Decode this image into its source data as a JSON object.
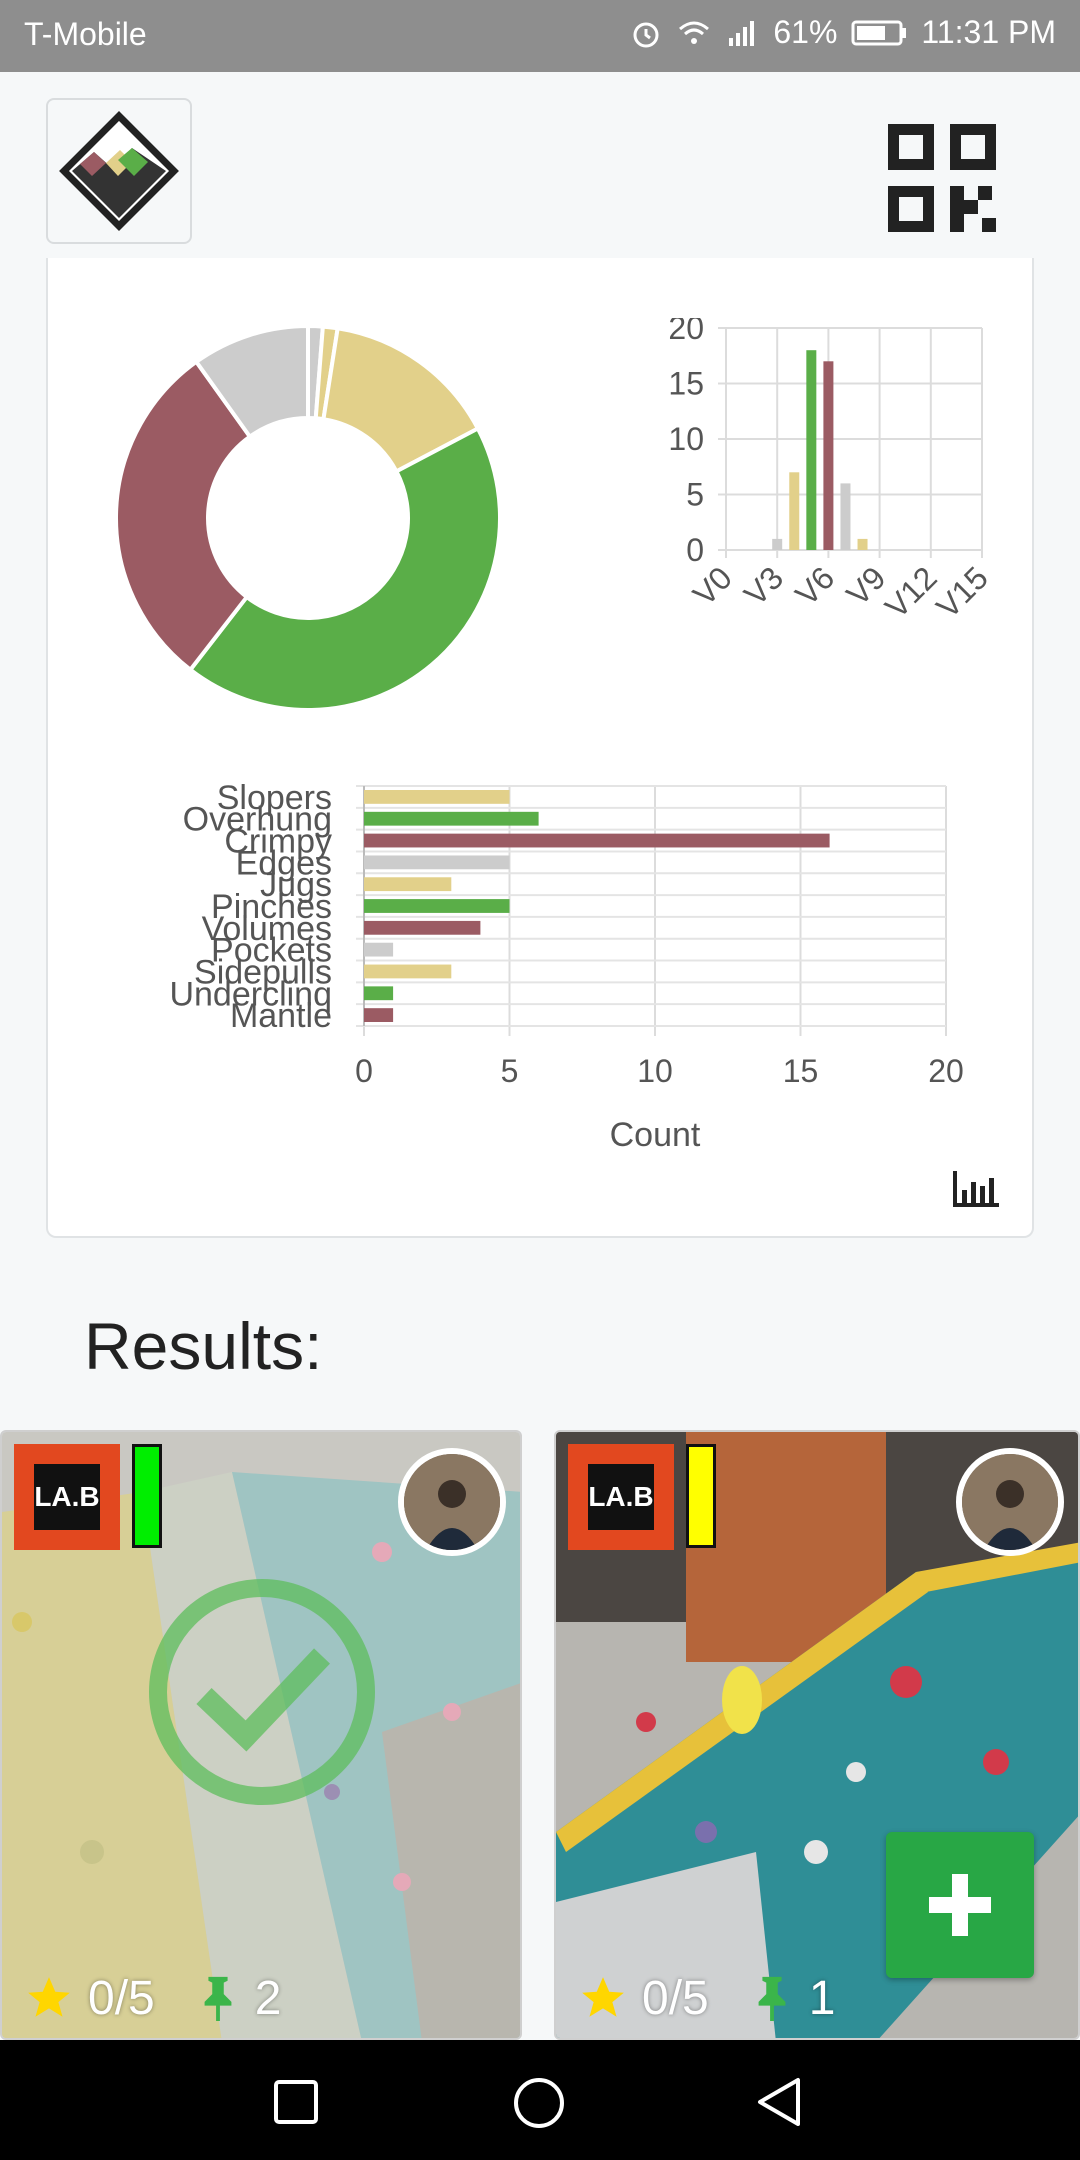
{
  "status_bar": {
    "carrier": "T-Mobile",
    "battery": "61%",
    "time": "11:31 PM"
  },
  "colors": {
    "tan": "#e2d08a",
    "green": "#5aae48",
    "maroon": "#9b5b63",
    "gray": "#cccccc",
    "gym_logo": "#e2481f",
    "add_button": "#28a745"
  },
  "chart_data": [
    {
      "type": "pie",
      "variant": "donut",
      "values": [
        1,
        1,
        12,
        35,
        24,
        8
      ],
      "colors": [
        "#cccccc",
        "#e2d08a",
        "#e2d08a",
        "#5aae48",
        "#9b5b63",
        "#cccccc"
      ]
    },
    {
      "type": "bar",
      "categories": [
        "V0",
        "V1",
        "V2",
        "V3",
        "V4",
        "V5",
        "V6",
        "V7",
        "V8",
        "V9",
        "V10",
        "V11",
        "V12",
        "V13",
        "V14",
        "V15"
      ],
      "tick_labels_x": [
        "V0",
        "V3",
        "V6",
        "V9",
        "V12",
        "V15"
      ],
      "values": [
        0,
        0,
        0,
        1,
        7,
        18,
        17,
        6,
        1,
        0,
        0,
        0,
        0,
        0,
        0,
        0
      ],
      "colors": [
        "#cccccc",
        "#cccccc",
        "#cccccc",
        "#cccccc",
        "#e2d08a",
        "#5aae48",
        "#9b5b63",
        "#cccccc",
        "#e2d08a",
        "#cccccc",
        "#cccccc",
        "#cccccc",
        "#cccccc",
        "#cccccc",
        "#cccccc",
        "#cccccc"
      ],
      "ylim": [
        0,
        20
      ],
      "yticks": [
        0,
        5,
        10,
        15,
        20
      ],
      "grid": true
    },
    {
      "type": "bar",
      "orientation": "horizontal",
      "categories": [
        "Slopers",
        "Overhung",
        "Crimpy",
        "Edges",
        "Jugs",
        "Pinches",
        "Volumes",
        "Pockets",
        "Sidepulls",
        "Underclinq",
        "Mantle"
      ],
      "values": [
        5,
        6,
        16,
        5,
        3,
        5,
        4,
        1,
        3,
        1,
        1
      ],
      "colors": [
        "#e2d08a",
        "#5aae48",
        "#9b5b63",
        "#cccccc",
        "#e2d08a",
        "#5aae48",
        "#9b5b63",
        "#cccccc",
        "#e2d08a",
        "#5aae48",
        "#9b5b63"
      ],
      "xlim": [
        0,
        20
      ],
      "xticks": [
        0,
        5,
        10,
        15,
        20
      ],
      "xlabel": "Count",
      "grid": true
    }
  ],
  "results": {
    "title": "Results:",
    "cards": [
      {
        "gym": "LA.B",
        "color_tag": "#00ee00",
        "stars": "0/5",
        "pins": "2",
        "sent": true
      },
      {
        "gym": "LA.B",
        "color_tag": "#ffff00",
        "stars": "0/5",
        "pins": "1",
        "sent": false
      }
    ]
  },
  "icons": {
    "logo": "mountain-logo-icon",
    "qr": "qr-code-icon",
    "chart_toggle": "bar-chart-icon",
    "star": "star-icon",
    "pin": "pin-icon",
    "check": "check-circle-icon",
    "add": "plus-icon"
  }
}
